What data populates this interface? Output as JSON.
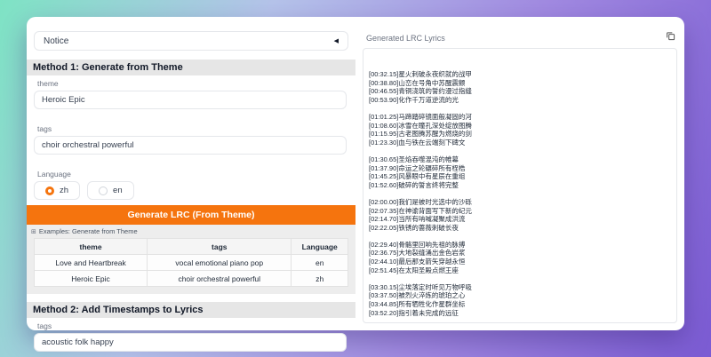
{
  "notice": {
    "label": "Notice"
  },
  "icons": {
    "collapse": "◀",
    "examples": "⊞"
  },
  "method1": {
    "title": "Method 1: Generate from Theme",
    "theme": {
      "label": "theme",
      "value": "Heroic Epic"
    },
    "tags": {
      "label": "tags",
      "value": "choir orchestral powerful"
    },
    "language": {
      "label": "Language",
      "value": "zh",
      "options": [
        {
          "label": "zh"
        },
        {
          "label": "en"
        }
      ]
    },
    "button": "Generate LRC (From Theme)"
  },
  "examples": {
    "title": "Examples: Generate from Theme",
    "columns": [
      "theme",
      "tags",
      "Language"
    ],
    "rows": [
      [
        "Love and Heartbreak",
        "vocal emotional piano pop",
        "en"
      ],
      [
        "Heroic Epic",
        "choir orchestral powerful",
        "zh"
      ]
    ]
  },
  "method2": {
    "title": "Method 2: Add Timestamps to Lyrics",
    "tags": {
      "label": "tags",
      "value": "acoustic folk happy"
    }
  },
  "output": {
    "label": "Generated LRC Lyrics",
    "lyrics": "[00:32.15]星火刺破永夜织就的战甲\n[00:38.80]山峦在号角中苏醒震颤\n[00:46.55]青铜浇筑的誓约漫过指缝\n[00:53.90]化作千万道逆流的光\n\n[01:01.25]马蹄踏碎镜面般凝固的河\n[01:08.60]冰雪在瞳孔深处绽放图腾\n[01:15.95]古老图腾苏醒为燃烧的剑\n[01:23.30]血与铁在云端刻下碑文\n\n[01:30.65]圣焰吞噬混沌的帷幕\n[01:37.90]命运之轮碾碎所有桎梏\n[01:45.25]风暴眼中有星辰在重组\n[01:52.60]破碎的誓言终将完整\n\n[02:00.00]我们是被时光选中的沙砾\n[02:07.35]在神谕背面写下新的纪元\n[02:14.70]当所有呐喊凝聚成洪流\n[02:22.05]铁锈的蔷薇刺破长夜\n\n[02:29.40]骨骼里回响先祖的脉搏\n[02:36.75]大地裂缝涌出金色岩浆\n[02:44.10]最后那支箭矢穿越永恒\n[02:51.45]在太阳圣殿点燃王座\n\n[03:30.15]尘埃落定时听见万物呼吸\n[03:37.50]被烈火淬炼的琥珀之心\n[03:44.85]所有牺牲化作星群坐标\n[03:52.20]指引着未完成的远征"
  },
  "colors": {
    "accent_orange": "#f5740e",
    "header_bg": "#e6e6e6",
    "card_bg": "#ffffff"
  }
}
